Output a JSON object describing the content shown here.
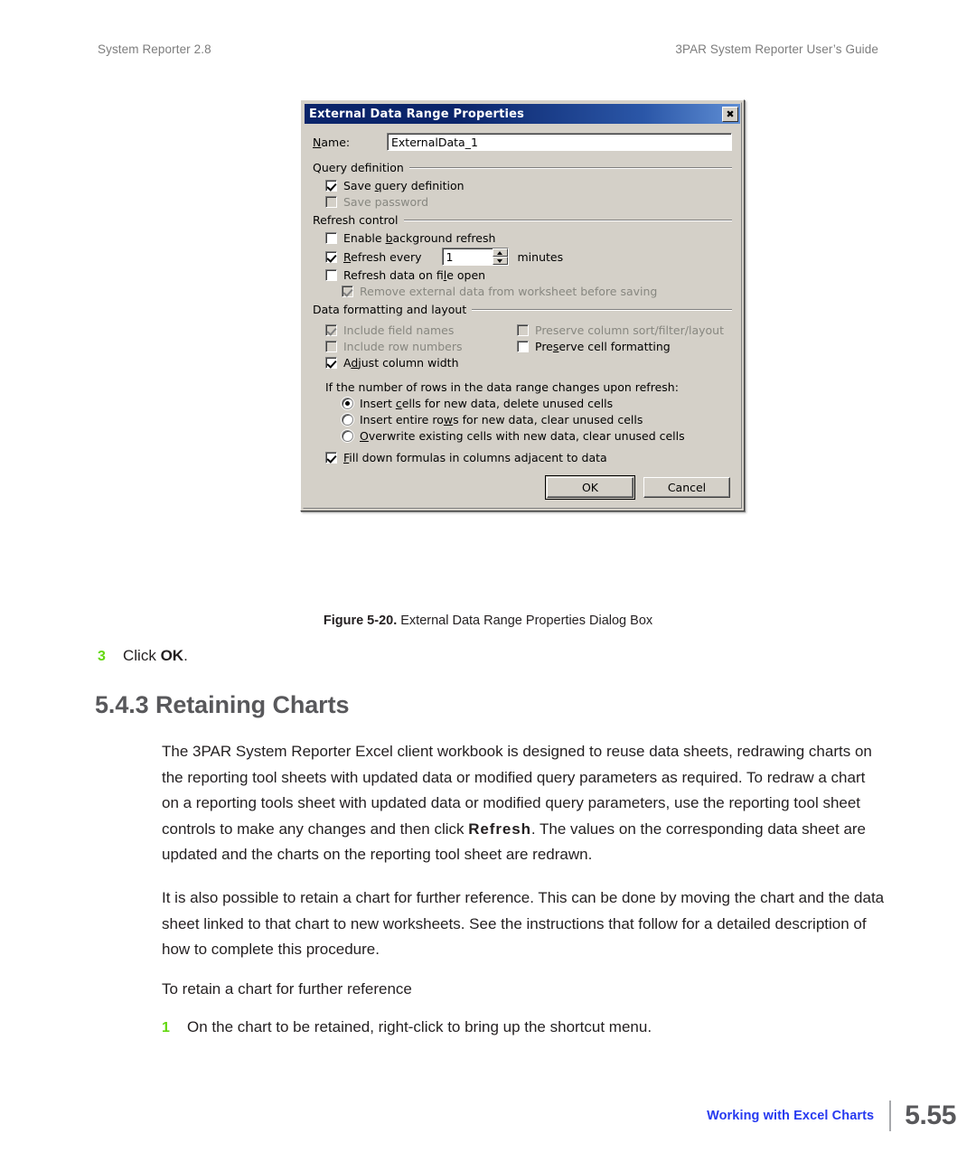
{
  "header": {
    "left": "System Reporter 2.8",
    "right": "3PAR System Reporter User’s Guide"
  },
  "dialog": {
    "title": "External Data Range Properties",
    "close_icon": "close-icon",
    "name_label": "Name:",
    "name_label_accel": "N",
    "name_value": "ExternalData_1",
    "groups": {
      "query_definition": {
        "legend": "Query definition",
        "options": [
          {
            "label": "Save query definition",
            "checked": true,
            "disabled": false,
            "accel": "q"
          },
          {
            "label": "Save password",
            "checked": false,
            "disabled": true,
            "accel": ""
          }
        ]
      },
      "refresh_control": {
        "legend": "Refresh control",
        "enable_background": {
          "label": "Enable background refresh",
          "checked": false,
          "disabled": false,
          "accel": "b"
        },
        "refresh_every": {
          "label": "Refresh every",
          "checked": true,
          "disabled": false,
          "accel": "R"
        },
        "refresh_value": "1",
        "refresh_units": "minutes",
        "refresh_on_open": {
          "label": "Refresh data on file open",
          "checked": false,
          "disabled": false,
          "accel": "l"
        },
        "remove_external": {
          "label": "Remove external data from worksheet before saving",
          "checked": true,
          "disabled": true,
          "accel": ""
        }
      },
      "data_formatting": {
        "legend": "Data formatting and layout",
        "left_column": [
          {
            "label": "Include field names",
            "checked": true,
            "disabled": true,
            "accel": ""
          },
          {
            "label": "Include row numbers",
            "checked": false,
            "disabled": true,
            "accel": ""
          },
          {
            "label": "Adjust column width",
            "checked": true,
            "disabled": false,
            "accel": "d"
          }
        ],
        "right_column": [
          {
            "label": "Preserve column sort/filter/layout",
            "checked": false,
            "disabled": true,
            "accel": ""
          },
          {
            "label": "Preserve cell formatting",
            "checked": false,
            "disabled": false,
            "accel": "s"
          }
        ]
      },
      "rows_change": {
        "prompt": "If the number of rows in the data range changes upon refresh:",
        "radios": [
          {
            "label": "Insert cells for new data, delete unused cells",
            "selected": true,
            "accel": "c"
          },
          {
            "label": "Insert entire rows for new data, clear unused cells",
            "selected": false,
            "accel": "w"
          },
          {
            "label": "Overwrite existing cells with new data, clear unused cells",
            "selected": false,
            "accel": "O"
          }
        ],
        "fill_down": {
          "label": "Fill down formulas in columns adjacent to data",
          "checked": true,
          "disabled": false,
          "accel": "F"
        }
      }
    },
    "buttons": {
      "ok": "OK",
      "cancel": "Cancel"
    }
  },
  "figure": {
    "number": "Figure 5-20.",
    "caption": "External Data Range Properties Dialog Box"
  },
  "body": {
    "step3_num": "3",
    "step3_pre": "Click ",
    "step3_bold": "OK",
    "step3_post": ".",
    "section_heading": "5.4.3 Retaining Charts",
    "para1_a": "The 3PAR System Reporter Excel client workbook is designed to reuse data sheets, redrawing charts on the reporting tool sheets with updated data or modified query parameters as required. To redraw a chart on a reporting tools sheet with updated data or modified query parameters, use the reporting tool sheet controls to make any changes and then click ",
    "para1_bold": "Refresh",
    "para1_b": ". The values on the corresponding data sheet are updated and the charts on the reporting tool sheet are redrawn.",
    "para2": "It is also possible to retain a chart for further reference. This can be done by moving the chart and the data sheet linked to that chart to new worksheets. See the instructions that follow for a detailed description of how to complete this procedure.",
    "lead": "To retain a chart for further reference",
    "step1_num": "1",
    "step1_text": "On the chart to be retained, right-click to bring up the shortcut menu."
  },
  "footer": {
    "title": "Working with Excel Charts",
    "page": "5.55"
  },
  "colors": {
    "step_number": "#63d80f",
    "heading": "#58585b",
    "footer_link": "#2639f0",
    "titlebar": "#0a246a",
    "dialog_face": "#d4d0c8"
  }
}
